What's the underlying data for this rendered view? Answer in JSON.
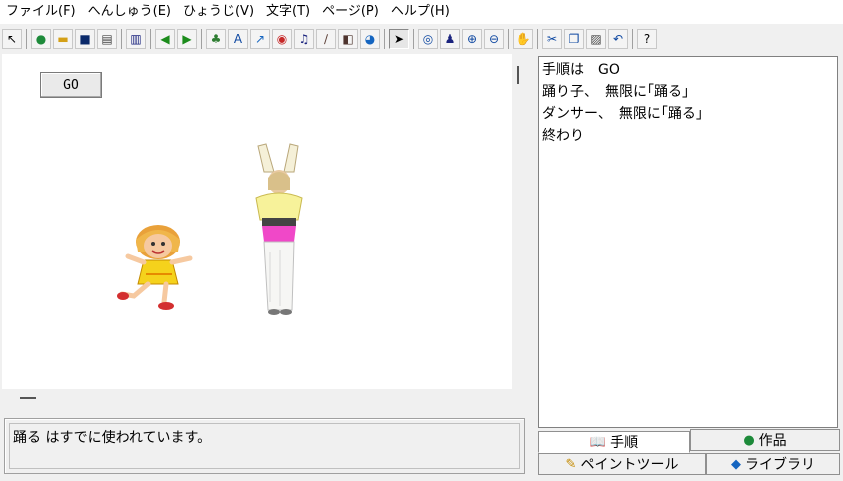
{
  "menu": [
    "ファイル(F)",
    "へんしゅう(E)",
    "ひょうじ(V)",
    "文字(T)",
    "ページ(P)",
    "ヘルプ(H)"
  ],
  "toolbar": {
    "buttons": [
      {
        "name": "pointer-small-button",
        "glyph": "↖",
        "color": "#000000"
      },
      {
        "name": "world-button",
        "glyph": "●",
        "color": "#1d8a3a"
      },
      {
        "name": "open-button",
        "glyph": "▬",
        "color": "#d4a017"
      },
      {
        "name": "save-button",
        "glyph": "■",
        "color": "#0b2a6b"
      },
      {
        "name": "print-button",
        "glyph": "▤",
        "color": "#444444"
      },
      {
        "name": "page-layout-button",
        "glyph": "▥",
        "color": "#1a237e"
      },
      {
        "name": "back-button",
        "glyph": "◀",
        "color": "#1c8c1c"
      },
      {
        "name": "forward-button",
        "glyph": "▶",
        "color": "#1c8c1c"
      },
      {
        "name": "plant-button",
        "glyph": "♣",
        "color": "#2e7d32"
      },
      {
        "name": "text-button",
        "glyph": "A",
        "color": "#0d47a1"
      },
      {
        "name": "rocket-button",
        "glyph": "↗",
        "color": "#1565c0"
      },
      {
        "name": "eye-button",
        "glyph": "◉",
        "color": "#c62828"
      },
      {
        "name": "music-button",
        "glyph": "♫",
        "color": "#1a237e"
      },
      {
        "name": "wand-button",
        "glyph": "∕",
        "color": "#5d4037"
      },
      {
        "name": "video-button",
        "glyph": "◧",
        "color": "#4e342e"
      },
      {
        "name": "globe-button",
        "glyph": "◕",
        "color": "#1565c0"
      },
      {
        "name": "arrow-pointer-button",
        "glyph": "➤",
        "color": "#000000"
      },
      {
        "name": "view-eye-button",
        "glyph": "◎",
        "color": "#0d47a1"
      },
      {
        "name": "stamp-button",
        "glyph": "♟",
        "color": "#1a237e"
      },
      {
        "name": "zoom-in-button",
        "glyph": "⊕",
        "color": "#0d47a1"
      },
      {
        "name": "zoom-out-button",
        "glyph": "⊖",
        "color": "#0d47a1"
      },
      {
        "name": "stop-button",
        "glyph": "✋",
        "color": "#d32f2f"
      },
      {
        "name": "cut-button",
        "glyph": "✂",
        "color": "#0d47a1"
      },
      {
        "name": "copy-button",
        "glyph": "❐",
        "color": "#0d47a1"
      },
      {
        "name": "paste-button",
        "glyph": "▨",
        "color": "#444444"
      },
      {
        "name": "undo-button",
        "glyph": "↶",
        "color": "#0d47a1"
      },
      {
        "name": "help-button",
        "glyph": "?",
        "color": "#000000"
      }
    ]
  },
  "stage": {
    "go_label": "GO"
  },
  "message": "踊る はすでに使われています。",
  "script": {
    "lines": [
      "手順は　GO",
      "踊り子、　無限に｢踊る｣",
      "ダンサー、　無限に｢踊る｣",
      "終わり"
    ]
  },
  "tabs": {
    "procedure": "手順",
    "works": "作品",
    "paint_tool": "ペイントツール",
    "library": "ライブラリ"
  },
  "icons": {
    "procedure": "book-icon",
    "works": "globe-icon",
    "paint_tool": "brush-icon",
    "library": "shapes-icon"
  }
}
